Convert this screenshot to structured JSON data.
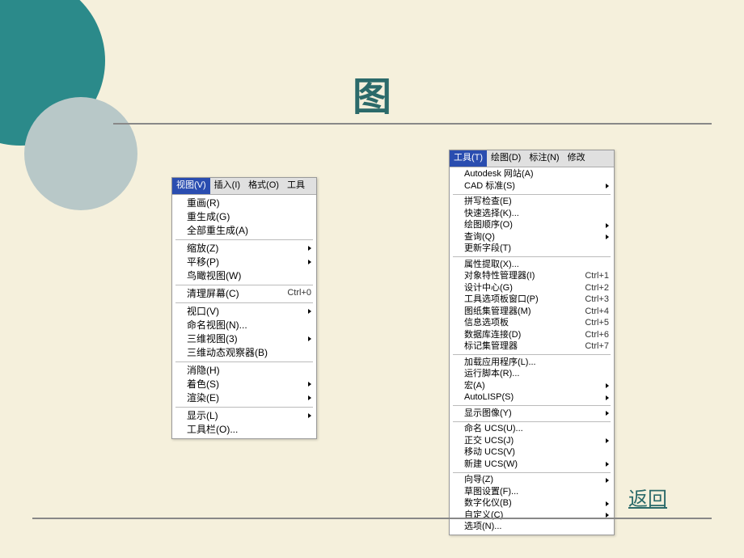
{
  "title": "图",
  "return_label": "返回",
  "left_menu": {
    "menubar": [
      {
        "label": "视图(V)",
        "active": true
      },
      {
        "label": "插入(I)",
        "active": false
      },
      {
        "label": "格式(O)",
        "active": false
      },
      {
        "label": "工具",
        "active": false
      }
    ],
    "groups": [
      [
        {
          "label": "重画(R)"
        },
        {
          "label": "重生成(G)"
        },
        {
          "label": "全部重生成(A)"
        }
      ],
      [
        {
          "label": "缩放(Z)",
          "submenu": true
        },
        {
          "label": "平移(P)",
          "submenu": true
        },
        {
          "label": "鸟瞰视图(W)"
        }
      ],
      [
        {
          "label": "清理屏幕(C)",
          "shortcut": "Ctrl+0"
        }
      ],
      [
        {
          "label": "视口(V)",
          "submenu": true
        },
        {
          "label": "命名视图(N)..."
        },
        {
          "label": "三维视图(3)",
          "submenu": true
        },
        {
          "label": "三维动态观察器(B)"
        }
      ],
      [
        {
          "label": "消隐(H)"
        },
        {
          "label": "着色(S)",
          "submenu": true
        },
        {
          "label": "渲染(E)",
          "submenu": true
        }
      ],
      [
        {
          "label": "显示(L)",
          "submenu": true
        },
        {
          "label": "工具栏(O)..."
        }
      ]
    ]
  },
  "right_menu": {
    "menubar": [
      {
        "label": "工具(T)",
        "active": true
      },
      {
        "label": "绘图(D)",
        "active": false
      },
      {
        "label": "标注(N)",
        "active": false
      },
      {
        "label": "修改",
        "active": false
      }
    ],
    "groups": [
      [
        {
          "label": "Autodesk 网站(A)"
        },
        {
          "label": "CAD 标准(S)",
          "submenu": true
        }
      ],
      [
        {
          "label": "拼写检查(E)"
        },
        {
          "label": "快速选择(K)..."
        },
        {
          "label": "绘图顺序(O)",
          "submenu": true
        },
        {
          "label": "查询(Q)",
          "submenu": true
        },
        {
          "label": "更新字段(T)"
        }
      ],
      [
        {
          "label": "属性提取(X)..."
        },
        {
          "label": "对象特性管理器(I)",
          "shortcut": "Ctrl+1"
        },
        {
          "label": "设计中心(G)",
          "shortcut": "Ctrl+2"
        },
        {
          "label": "工具选项板窗口(P)",
          "shortcut": "Ctrl+3"
        },
        {
          "label": "图纸集管理器(M)",
          "shortcut": "Ctrl+4"
        },
        {
          "label": "信息选项板",
          "shortcut": "Ctrl+5"
        },
        {
          "label": "数据库连接(D)",
          "shortcut": "Ctrl+6"
        },
        {
          "label": "标记集管理器",
          "shortcut": "Ctrl+7"
        }
      ],
      [
        {
          "label": "加载应用程序(L)..."
        },
        {
          "label": "运行脚本(R)..."
        },
        {
          "label": "宏(A)",
          "submenu": true
        },
        {
          "label": "AutoLISP(S)",
          "submenu": true
        }
      ],
      [
        {
          "label": "显示图像(Y)",
          "submenu": true
        }
      ],
      [
        {
          "label": "命名 UCS(U)..."
        },
        {
          "label": "正交 UCS(J)",
          "submenu": true
        },
        {
          "label": "移动 UCS(V)"
        },
        {
          "label": "新建 UCS(W)",
          "submenu": true
        }
      ],
      [
        {
          "label": "向导(Z)",
          "submenu": true
        },
        {
          "label": "草图设置(F)..."
        },
        {
          "label": "数字化仪(B)",
          "submenu": true
        },
        {
          "label": "自定义(C)",
          "submenu": true
        },
        {
          "label": "选项(N)..."
        }
      ]
    ]
  }
}
